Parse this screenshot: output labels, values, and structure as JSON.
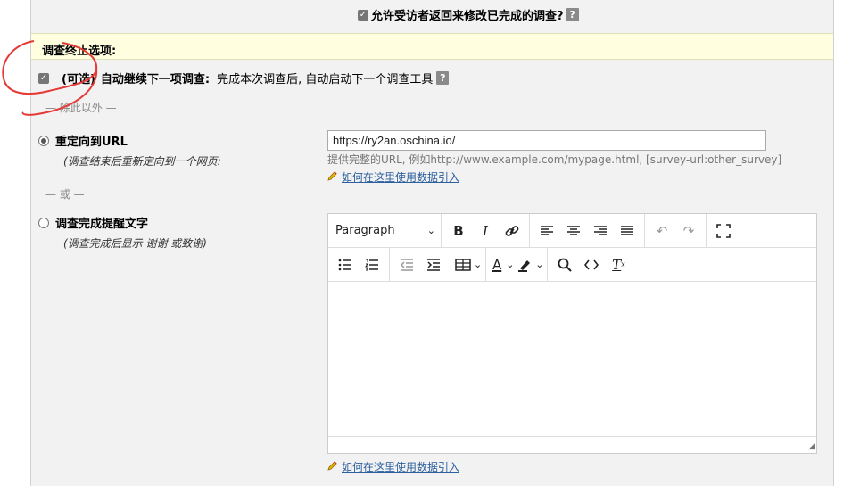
{
  "allow_return": {
    "label": "允许受访者返回来修改已完成的调查?",
    "checked": true
  },
  "help_glyph": "?",
  "section": {
    "title": "调查终止选项:"
  },
  "continue": {
    "optional": "(可选)",
    "label": "自动继续下一项调查:",
    "desc": "完成本次调查后, 自动启动下一个调查工具",
    "checked": true
  },
  "sep_except": "— 除此以外 —",
  "sep_or": "— 或 —",
  "redirect": {
    "title": "重定向到URL",
    "subtitle": "(调查结束后重新定向到一个网页:",
    "selected": true,
    "url_value": "https://ry2an.oschina.io/",
    "hint": "提供完整的URL, 例如http://www.example.com/mypage.html, [survey-url:other_survey]"
  },
  "completion": {
    "title": "调查完成提醒文字",
    "subtitle": "(调查完成后显示 谢谢 或致谢)",
    "selected": false
  },
  "data_link": "如何在这里使用数据引入",
  "editor": {
    "format": "Paragraph"
  },
  "icons": [
    "pencil-icon",
    "bold-icon",
    "italic-icon",
    "link-icon",
    "align-left-icon",
    "align-center-icon",
    "align-right-icon",
    "align-justify-icon",
    "undo-icon",
    "redo-icon",
    "fullscreen-icon",
    "bullet-list-icon",
    "numbered-list-icon",
    "outdent-icon",
    "indent-icon",
    "table-icon",
    "text-color-icon",
    "highlight-icon",
    "search-icon",
    "code-icon",
    "clear-format-icon"
  ],
  "colors": {
    "panel": "#f2f2f2",
    "header_bg": "#ffffe0",
    "link": "#2c5f9e",
    "annotation": "#e53935"
  }
}
